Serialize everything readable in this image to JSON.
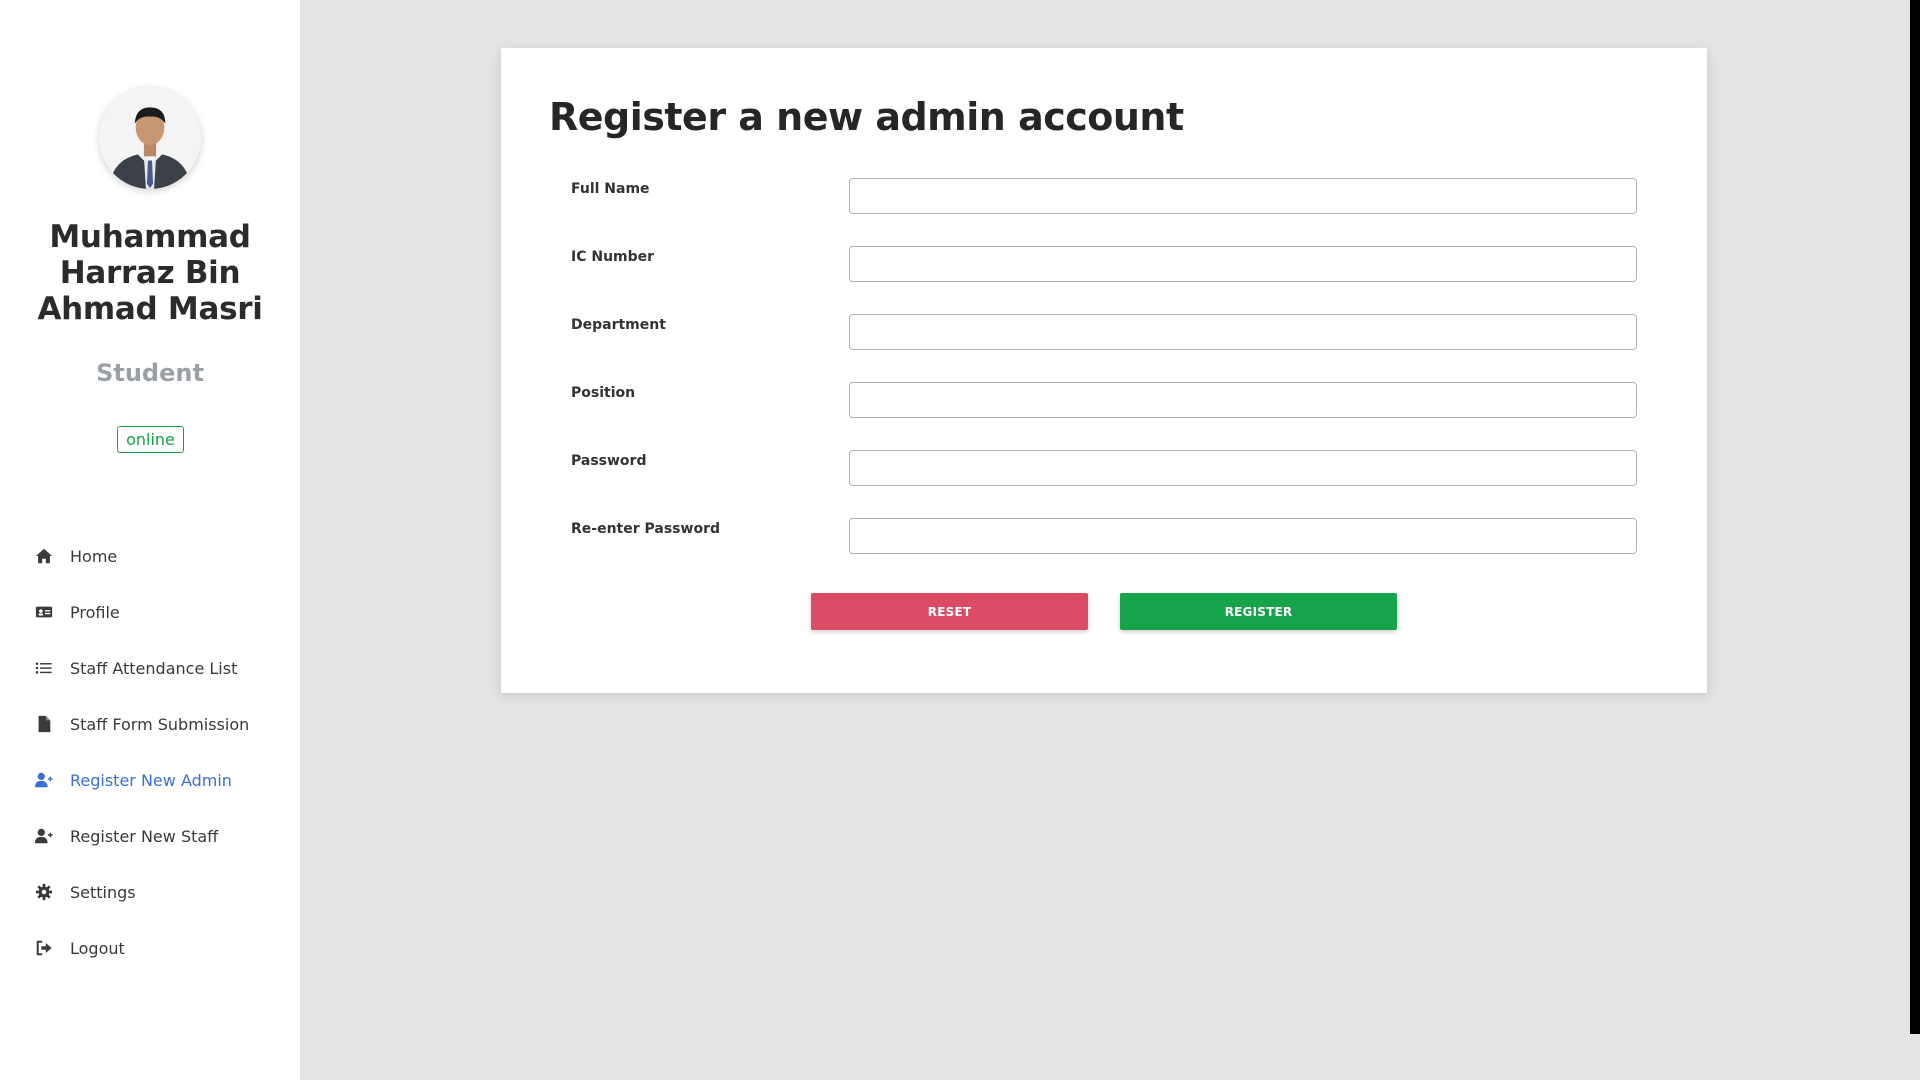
{
  "sidebar": {
    "user": {
      "name": "Muhammad Harraz Bin Ahmad Masri",
      "role": "Student",
      "status": "online"
    },
    "items": [
      {
        "label": "Home",
        "icon": "home-icon"
      },
      {
        "label": "Profile",
        "icon": "id-card-icon"
      },
      {
        "label": "Staff Attendance List",
        "icon": "list-icon"
      },
      {
        "label": "Staff Form Submission",
        "icon": "file-icon"
      },
      {
        "label": "Register New Admin",
        "icon": "user-plus-icon",
        "active": true
      },
      {
        "label": "Register New Staff",
        "icon": "user-plus-icon"
      },
      {
        "label": "Settings",
        "icon": "gear-icon"
      },
      {
        "label": "Logout",
        "icon": "sign-out-icon"
      }
    ]
  },
  "form": {
    "title": "Register a new admin account",
    "fields": [
      {
        "label": "Full Name",
        "value": ""
      },
      {
        "label": "IC Number",
        "value": ""
      },
      {
        "label": "Department",
        "value": ""
      },
      {
        "label": "Position",
        "value": ""
      },
      {
        "label": "Password",
        "value": ""
      },
      {
        "label": "Re-enter Password",
        "value": ""
      }
    ],
    "reset_label": "RESET",
    "register_label": "REGISTER"
  },
  "colors": {
    "accent": "#3b6fd6",
    "online": "#16a34a",
    "reset": "#dc4b64",
    "register": "#17a34a"
  }
}
